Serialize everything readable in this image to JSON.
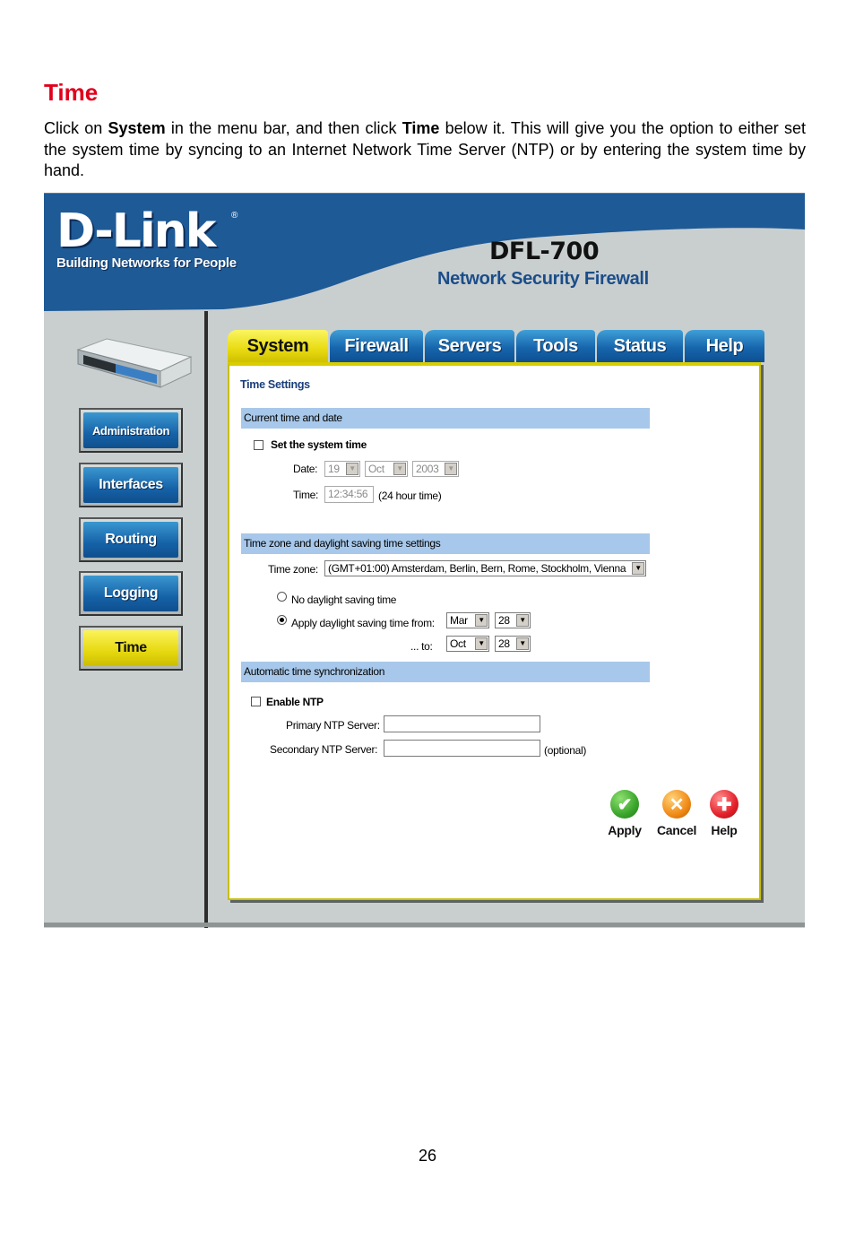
{
  "doc": {
    "title": "Time",
    "intro": {
      "p1": "Click on ",
      "b1": "System",
      "p2": " in the menu bar, and then click ",
      "b2": "Time",
      "p3": " below it. This will give you the option to either set the system time by syncing to an Internet Network Time Server (NTP) or by entering the system time by hand."
    },
    "page_number": "26"
  },
  "banner": {
    "logo": "D-Link",
    "registered": "®",
    "tagline": "Building Networks for People",
    "product": "DFL-700",
    "product_sub": "Network Security Firewall"
  },
  "sidebar": {
    "items": [
      {
        "label": "Administration"
      },
      {
        "label": "Interfaces"
      },
      {
        "label": "Routing"
      },
      {
        "label": "Logging"
      },
      {
        "label": "Time"
      }
    ]
  },
  "tabs": [
    {
      "label": "System"
    },
    {
      "label": "Firewall"
    },
    {
      "label": "Servers"
    },
    {
      "label": "Tools"
    },
    {
      "label": "Status"
    },
    {
      "label": "Help"
    }
  ],
  "panel": {
    "title": "Time Settings",
    "section_current": "Current time and date",
    "set_system_time": "Set the system time",
    "date_label": "Date:",
    "date_day": "19",
    "date_month": "Oct",
    "date_year": "2003",
    "time_label": "Time:",
    "time_value": "12:34:56",
    "time_hint": "(24 hour time)",
    "section_timezone": "Time zone and daylight saving time settings",
    "timezone_label": "Time zone:",
    "timezone_value": "(GMT+01:00) Amsterdam, Berlin, Bern, Rome, Stockholm, Vienna",
    "no_dst": "No daylight saving time",
    "apply_dst_from": "Apply daylight saving time from:",
    "dst_from_month": "Mar",
    "dst_from_day": "28",
    "dst_to_label": "... to:",
    "dst_to_month": "Oct",
    "dst_to_day": "28",
    "section_ntp": "Automatic time synchronization",
    "enable_ntp": "Enable NTP",
    "primary_ntp_label": "Primary NTP Server:",
    "secondary_ntp_label": "Secondary NTP Server:",
    "optional_hint": "(optional)",
    "apply_label": "Apply",
    "cancel_label": "Cancel",
    "help_label": "Help"
  },
  "colors": {
    "title_red": "#e0001b",
    "banner_blue": "#1e5a96",
    "tab_blue": "#1766ad",
    "active_yellow": "#e8db12",
    "section_blue": "#a7c8ea",
    "apply_green": "#3aa52b",
    "cancel_orange": "#f08a16",
    "help_red": "#e3202a"
  }
}
